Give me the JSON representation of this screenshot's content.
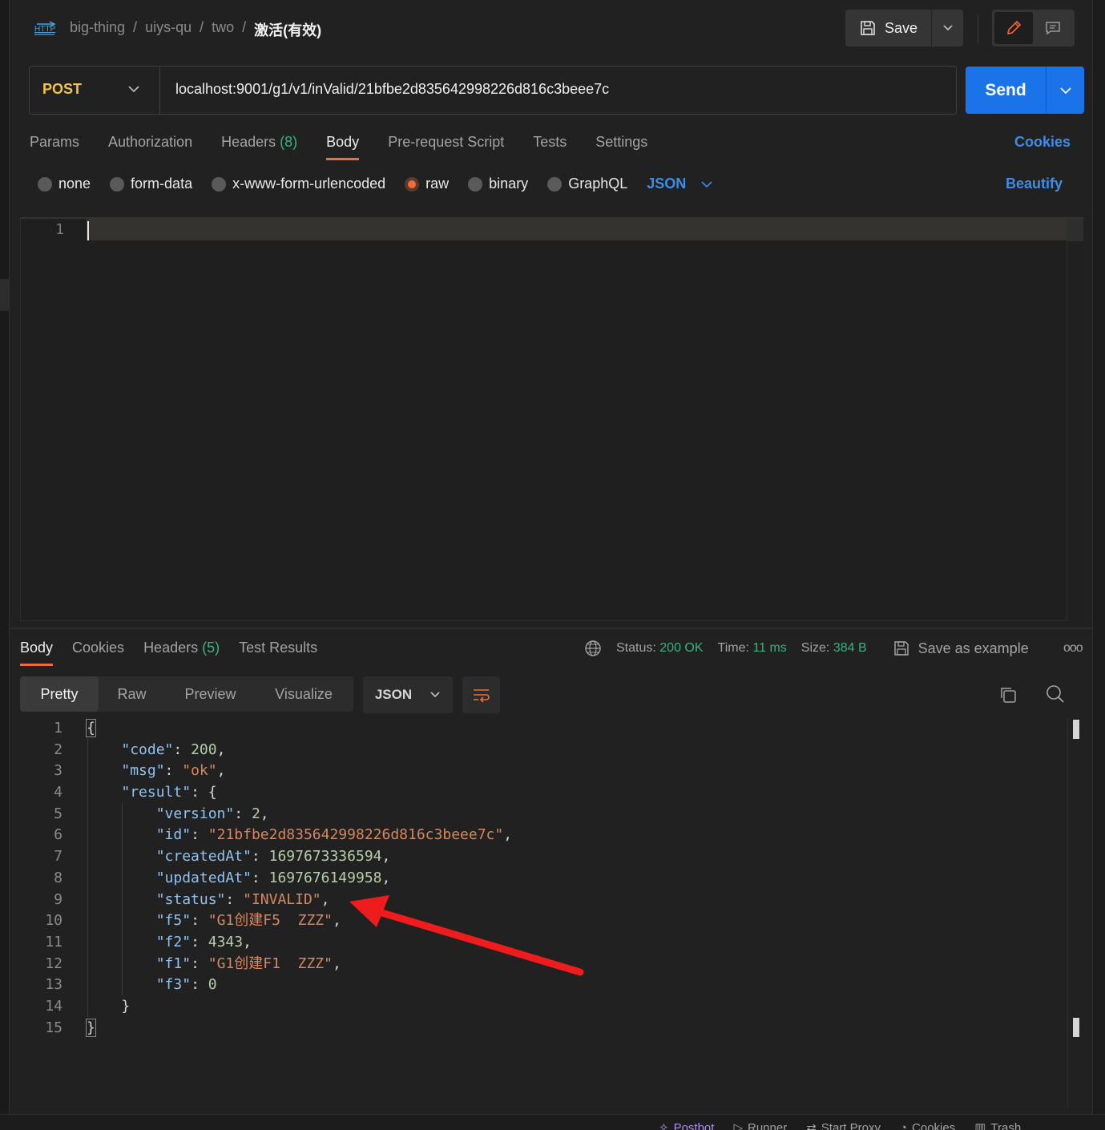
{
  "header": {
    "request_type_icon": "HTTP",
    "breadcrumbs": [
      "big-thing",
      "uiys-qu",
      "two"
    ],
    "separator": "/",
    "request_name": "激活(有效)",
    "save_label": "Save"
  },
  "request": {
    "method": "POST",
    "url": "localhost:9001/g1/v1/inValid/21bfbe2d835642998226d816c3beee7c",
    "send_label": "Send",
    "tabs": [
      {
        "label": "Params"
      },
      {
        "label": "Authorization"
      },
      {
        "label": "Headers",
        "count": "(8)"
      },
      {
        "label": "Body",
        "active": true
      },
      {
        "label": "Pre-request Script"
      },
      {
        "label": "Tests"
      },
      {
        "label": "Settings"
      }
    ],
    "cookies_link": "Cookies",
    "body_types": [
      {
        "label": "none"
      },
      {
        "label": "form-data"
      },
      {
        "label": "x-www-form-urlencoded"
      },
      {
        "label": "raw",
        "selected": true
      },
      {
        "label": "binary"
      },
      {
        "label": "GraphQL"
      }
    ],
    "body_format": "JSON",
    "beautify_label": "Beautify",
    "editor_line_number": "1"
  },
  "response": {
    "tabs": [
      {
        "label": "Body",
        "active": true
      },
      {
        "label": "Cookies"
      },
      {
        "label": "Headers",
        "count": "(5)"
      },
      {
        "label": "Test Results"
      }
    ],
    "status_label": "Status:",
    "status_value": "200 OK",
    "time_label": "Time:",
    "time_value": "11 ms",
    "size_label": "Size:",
    "size_value": "384 B",
    "save_example_label": "Save as example",
    "more_label": "ooo",
    "views": [
      "Pretty",
      "Raw",
      "Preview",
      "Visualize"
    ],
    "format": "JSON",
    "line_numbers": [
      "1",
      "2",
      "3",
      "4",
      "5",
      "6",
      "7",
      "8",
      "9",
      "10",
      "11",
      "12",
      "13",
      "14",
      "15"
    ],
    "json": {
      "code": 200,
      "msg": "ok",
      "result": {
        "version": 2,
        "id": "21bfbe2d835642998226d816c3beee7c",
        "createdAt": 1697673336594,
        "updatedAt": 1697676149958,
        "status": "INVALID",
        "f5": "G1创建F5  ZZZ",
        "f2": 4343,
        "f1": "G1创建F1  ZZZ",
        "f3": 0
      }
    }
  },
  "footer": {
    "items": [
      "Postbot",
      "Runner",
      "Start Proxy",
      "Cookies",
      "Trash"
    ]
  },
  "colors": {
    "accent": "#f26b3a",
    "link": "#3d8de8",
    "send": "#1a73e8",
    "method": "#f5c34b",
    "success": "#36b37e",
    "annotation_arrow": "#ee1c1c"
  }
}
